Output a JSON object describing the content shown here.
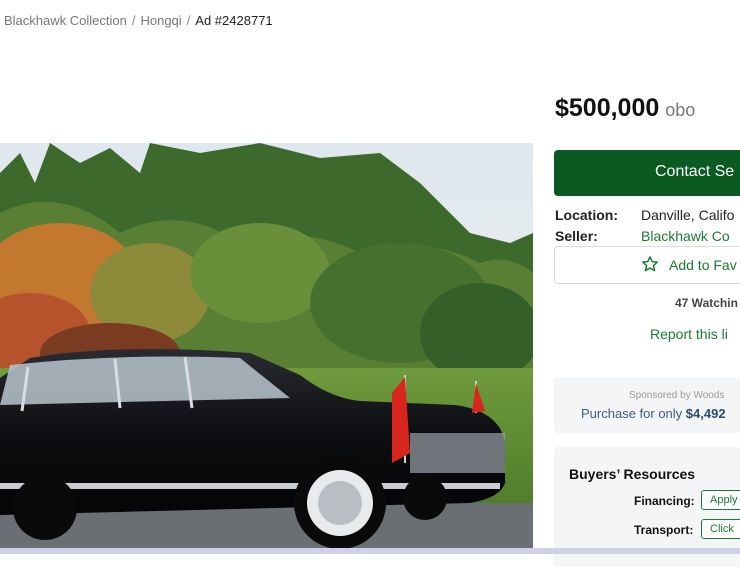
{
  "breadcrumb": {
    "items": [
      "Blackhawk Collection",
      "Hongqi"
    ],
    "separator": "/",
    "current": "Ad #2428771"
  },
  "listing": {
    "price": "$500,000",
    "price_qualifier": "obo",
    "contact_button": "Contact Se",
    "location_label": "Location:",
    "location_value": "Danville, Califo",
    "seller_label": "Seller:",
    "seller_value": "Blackhawk Co",
    "favorite_button": "Add to Fav",
    "watching": "47 Watchin",
    "report_link": "Report this li"
  },
  "sponsor": {
    "by": "Sponsored by Woods",
    "purchase_prefix": "Purchase for only",
    "purchase_amount": "$4,492"
  },
  "resources": {
    "title": "Buyers’ Resources",
    "rows": [
      {
        "label": "Financing:",
        "button": "Apply"
      },
      {
        "label": "Transport:",
        "button": "Click"
      }
    ]
  },
  "colors": {
    "brand_green": "#0b5a22",
    "link_green": "#1b7a34",
    "sponsor_blue": "#2b4b7a"
  },
  "icons": [
    "star-outline-icon"
  ]
}
